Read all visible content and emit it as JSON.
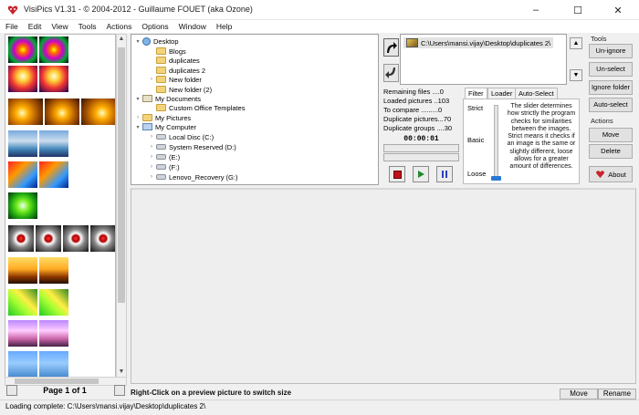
{
  "window": {
    "title": "VisiPics V1.31 - © 2004-2012 - Guillaume FOUET (aka Ozone)",
    "minimize": "–",
    "maximize": "☐",
    "close": "✕"
  },
  "menu": [
    "File",
    "Edit",
    "View",
    "Tools",
    "Actions",
    "Options",
    "Window",
    "Help"
  ],
  "thumbnails": {
    "pager_label": "Page 1 of 1"
  },
  "tree": {
    "desktop": "Desktop",
    "blogs": "Blogs",
    "duplicates": "duplicates",
    "duplicates2": "duplicates 2",
    "new_folder": "New folder",
    "new_folder2": "New folder (2)",
    "my_documents": "My Documents",
    "custom_office": "Custom Office Templates",
    "my_pictures": "My Pictures",
    "my_computer": "My Computer",
    "local_disc": "Local Disc (C:)",
    "system_reserved": "System Reserved (D:)",
    "drive_e": "(E:)",
    "drive_f": "(F:)",
    "lenovo": "Lenovo_Recovery (G:)"
  },
  "queue": {
    "path": "C:\\Users\\mansi.vijay\\Desktop\\duplicates 2\\"
  },
  "stats": {
    "remaining": "Remaining files ....0",
    "loaded": "Loaded pictures ..103",
    "to_compare": "To compare .........0",
    "duplicates": "Duplicate pictures...70",
    "groups": "Duplicate groups ....30",
    "timer": "00:00:01"
  },
  "tabs": {
    "filter": "Filter",
    "loader": "Loader",
    "auto_select": "Auto-Select"
  },
  "filter": {
    "strict": "Strict",
    "basic": "Basic",
    "loose": "Loose",
    "level": 1.0,
    "description": "The slider determines how strictly the program checks for similarities between the images. Strict means it checks if an image is the same or slightly different, loose allows for a greater amount of differences."
  },
  "tools": {
    "label": "Tools",
    "unignore": "Un-ignore",
    "unselect": "Un-select",
    "ignore_folder": "Ignore folder",
    "auto_select": "Auto-select"
  },
  "actions": {
    "label": "Actions",
    "move": "Move",
    "delete": "Delete",
    "about": "About"
  },
  "preview": {
    "hint": "Right-Click on a preview picture to switch size",
    "move": "Move",
    "rename": "Rename"
  },
  "status": {
    "text": "Loading complete: C:\\Users\\mansi.vijay\\Desktop\\duplicates 2\\"
  },
  "colors": {
    "accent": "#2a78d4",
    "stop": "#c0101a",
    "play": "#1f8a2b",
    "pause": "#2b3fbf"
  }
}
